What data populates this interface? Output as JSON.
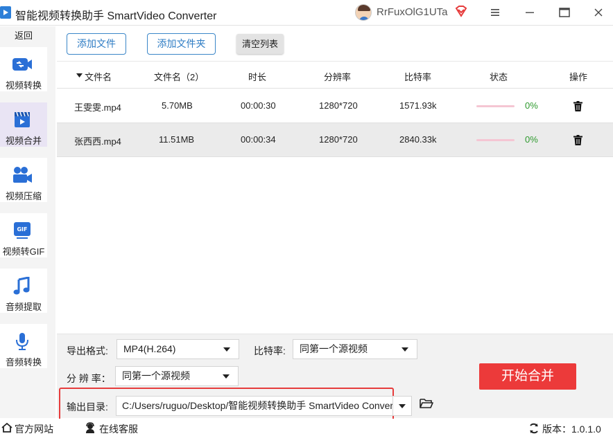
{
  "app": {
    "title": "智能视频转换助手 SmartVideo Converter",
    "username": "RrFuxOlG1UTa",
    "colors": {
      "accent": "#3a86c8",
      "start": "#ec3a3a",
      "active_nav": "#e9e4f4",
      "progress": "#e8577f"
    }
  },
  "sidebar": {
    "back_label": "返回",
    "items": [
      {
        "label": "视频转换",
        "icon": "video-convert-icon"
      },
      {
        "label": "视频合并",
        "icon": "video-merge-icon"
      },
      {
        "label": "视频压缩",
        "icon": "video-compress-icon"
      },
      {
        "label": "视频转GIF",
        "icon": "gif-icon"
      },
      {
        "label": "音频提取",
        "icon": "music-note-icon"
      },
      {
        "label": "音频转换",
        "icon": "microphone-icon"
      }
    ]
  },
  "toolbar": {
    "add_file": "添加文件",
    "add_folder": "添加文件夹",
    "clear_list": "清空列表"
  },
  "table": {
    "columns": [
      "文件名",
      "文件名（2）",
      "时长",
      "分辨率",
      "比特率",
      "状态",
      "操作"
    ],
    "rows": [
      {
        "name": "王雯雯.mp4",
        "size": "5.70MB",
        "duration": "00:00:30",
        "resolution": "1280*720",
        "bitrate": "1571.93k",
        "progress": 0,
        "progress_label": "0%"
      },
      {
        "name": "张西西.mp4",
        "size": "11.51MB",
        "duration": "00:00:34",
        "resolution": "1280*720",
        "bitrate": "2840.33k",
        "progress": 0,
        "progress_label": "0%"
      }
    ]
  },
  "settings": {
    "format_label": "导出格式:",
    "format_value": "MP4(H.264)",
    "bitrate_label": "比特率:",
    "bitrate_value": "同第一个源视频",
    "resolution_label": "分 辨 率：",
    "resolution_value": "同第一个源视频",
    "output_label": "输出目录:",
    "output_path": "C:/Users/ruguo/Desktop/智能视频转换助手 SmartVideo Converter",
    "start_button": "开始合并"
  },
  "status": {
    "website": "官方网站",
    "support": "在线客服",
    "version": "版本：1.0.1.0"
  }
}
